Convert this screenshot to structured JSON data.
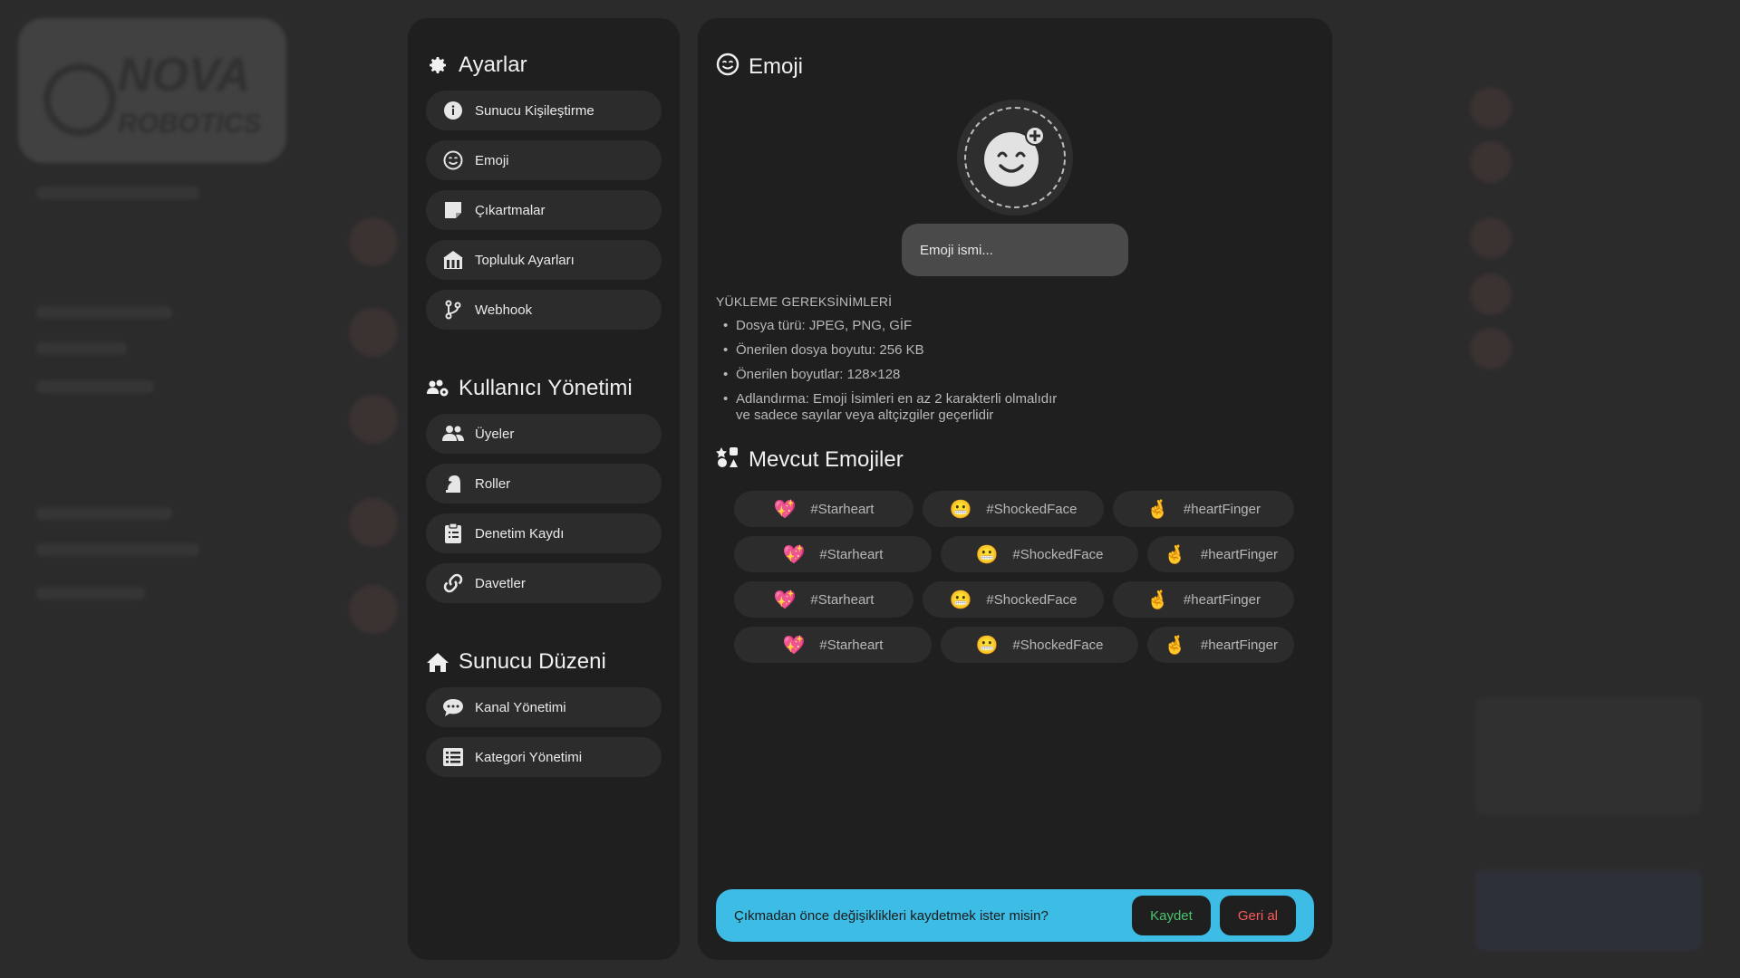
{
  "settings": {
    "title": "Ayarlar",
    "items": [
      {
        "label": "Sunucu Kişileştirme"
      },
      {
        "label": "Emoji"
      },
      {
        "label": "Çıkartmalar"
      },
      {
        "label": "Topluluk Ayarları"
      },
      {
        "label": "Webhook"
      }
    ]
  },
  "user_management": {
    "title": "Kullanıcı Yönetimi",
    "items": [
      {
        "label": "Üyeler"
      },
      {
        "label": "Roller"
      },
      {
        "label": "Denetim Kaydı"
      },
      {
        "label": "Davetler"
      }
    ]
  },
  "server_layout": {
    "title": "Sunucu Düzeni",
    "items": [
      {
        "label": "Kanal Yönetimi"
      },
      {
        "label": "Kategori Yönetimi"
      }
    ]
  },
  "emoji_page": {
    "title": "Emoji",
    "name_placeholder": "Emoji ismi...",
    "requirements_title": "YÜKLEME GEREKSİNİMLERİ",
    "requirements": [
      "Dosya türü: JPEG, PNG, GİF",
      "Önerilen dosya boyutu: 256 KB",
      "Önerilen boyutlar: 128×128",
      "Adlandırma: Emoji İsimleri en az 2 karakterli olmalıdır",
      "ve sadece sayılar veya altçizgiler geçerlidir"
    ],
    "available_title": "Mevcut Emojiler",
    "emojis": [
      {
        "glyph": "💖",
        "name": "#Starheart"
      },
      {
        "glyph": "😬",
        "name": "#ShockedFace"
      },
      {
        "glyph": "🤞",
        "name": "#heartFinger"
      },
      {
        "glyph": "💖",
        "name": "#Starheart"
      },
      {
        "glyph": "😬",
        "name": "#ShockedFace"
      },
      {
        "glyph": "🤞",
        "name": "#heartFinger"
      },
      {
        "glyph": "💖",
        "name": "#Starheart"
      },
      {
        "glyph": "😬",
        "name": "#ShockedFace"
      },
      {
        "glyph": "🤞",
        "name": "#heartFinger"
      },
      {
        "glyph": "💖",
        "name": "#Starheart"
      },
      {
        "glyph": "😬",
        "name": "#ShockedFace"
      },
      {
        "glyph": "🤞",
        "name": "#heartFinger"
      }
    ]
  },
  "save_bar": {
    "message": "Çıkmadan önce değişiklikleri kaydetmek ister misin?",
    "save_label": "Kaydet",
    "revert_label": "Geri al"
  },
  "background": {
    "logo_text": "NOVA",
    "logo_subtext": "ROBOTICS"
  },
  "colors": {
    "accent": "#3dbde5",
    "save": "#4cc26e",
    "revert": "#ff5a5a",
    "panel": "#1f1f1f",
    "chip": "#2c2c2c"
  }
}
